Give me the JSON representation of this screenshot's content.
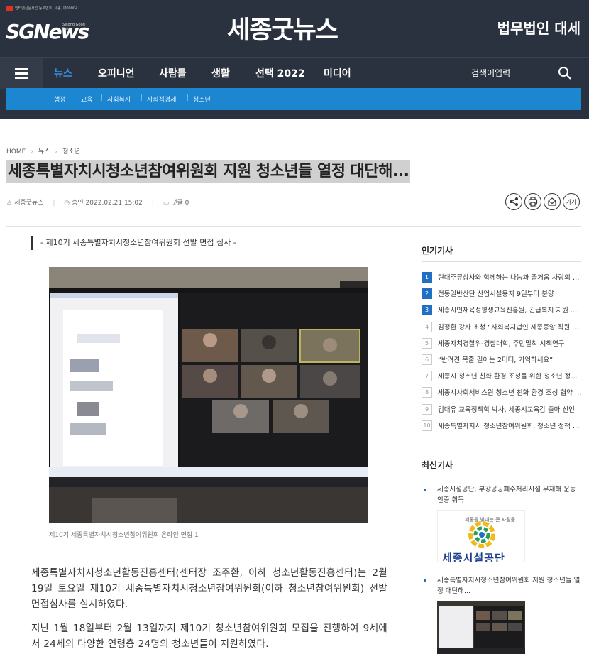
{
  "header": {
    "logo_tagline": "인터넷신문사업 등록번호, 세종, 아00004",
    "logo_text": "SGNews",
    "logo_sub": "Sejong Good News",
    "site_title": "세종굿뉴스",
    "ad_link": "법무법인 대세"
  },
  "nav": {
    "items": [
      "뉴스",
      "오피니언",
      "사람들",
      "생활",
      "선택 2022",
      "미디어"
    ],
    "active_index": 0,
    "search_placeholder": "검색어입력",
    "search_icon": "magnifier-icon"
  },
  "subnav": {
    "items": [
      "행정",
      "교육",
      "사회복지",
      "사회적경제",
      "청소년"
    ]
  },
  "breadcrumb": [
    "HOME",
    "뉴스",
    "청소년"
  ],
  "article": {
    "headline": "세종특별자치시청소년참여위원회 지원 청소년들 열정 대단해...",
    "author": "세종굿뉴스",
    "approved_label": "승인 2022.02.21 15:02",
    "comments_label": "댓글 0",
    "font_button": "가가",
    "subtitle": "- 제10기 세종특별자치시청소년참여위원회 선발 면접 심사 -",
    "caption": "제10기 세종특별자치시청소년참여위원회 온라인 면접 1",
    "paragraphs": [
      "세종특별자치시청소년활동진흥센터(센터장 조주환, 이하 청소년활동진흥센터)는 2월 19일 토요일 제10기 세종특별자치시청소년참여위원회(이하 청소년참여위원회) 선발 면접심사를 실시하였다.",
      "지난 1월 18일부터 2월 13일까지 제10기 청소년참여위원회 모집을 진행하여 9세에서 24세의 다양한 연령층 24명의 청소년들이 지원하였다."
    ]
  },
  "sidebar": {
    "popular_title": "인기기사",
    "popular": [
      {
        "rank": "1",
        "title": "현대주류상사와 함께하는 나눔과 즐거움 사랑의 쌀 기부"
      },
      {
        "rank": "2",
        "title": "전동일반산단 산업시설용지 9일부터 분양"
      },
      {
        "rank": "3",
        "title": "세종시인재육성평생교육진흥원, 긴급복지 지원 협약"
      },
      {
        "rank": "4",
        "title": "김정환 강사 초청 “사회복지법인 세종중앙 직원 교육”"
      },
      {
        "rank": "5",
        "title": "세종자치경찰위-경찰대학, 주민밀착 시책연구"
      },
      {
        "rank": "6",
        "title": "“반려견 목줄 길이는 2미터, 기억하세요”"
      },
      {
        "rank": "7",
        "title": "세종시 청소년 친화 환경 조성을 위한 청소년 정책 제안"
      },
      {
        "rank": "8",
        "title": "세종시사회서비스원 청소년 친화 환경 조성 협약 체결"
      },
      {
        "rank": "9",
        "title": "김대유 교육정책학 박사, 세종시교육감 출마 선언"
      },
      {
        "rank": "10",
        "title": "세종특별자치시 청소년참여위원회, 청소년 정책 제안"
      }
    ],
    "latest_title": "최신기사",
    "latest": [
      {
        "title": "세종시설공단, 부강공공폐수처리시설 무재해 운동 인증 취득",
        "thumb_text": "세종을 빛내는 큰 사람들",
        "thumb_brand": "세종시설공단"
      },
      {
        "title": "세종특별자치시청소년참여위원회 지원 청소년들 열정 대단해..."
      }
    ]
  }
}
